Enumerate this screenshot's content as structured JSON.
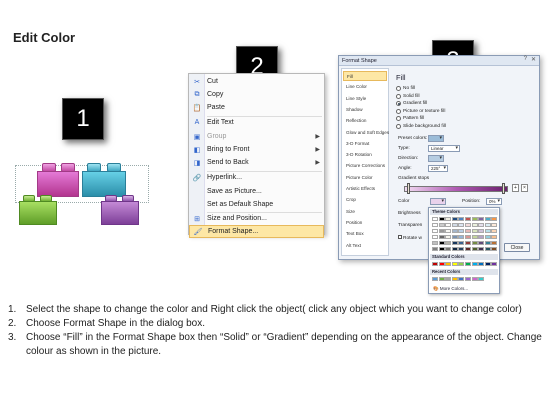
{
  "title": "Edit Color",
  "steps": [
    "1",
    "2",
    "3"
  ],
  "context_menu": {
    "items": [
      {
        "label": "Cut",
        "icon": "cut-icon",
        "glyph": "✂",
        "arrow": false,
        "disabled": false
      },
      {
        "label": "Copy",
        "icon": "copy-icon",
        "glyph": "⧉",
        "arrow": false,
        "disabled": false
      },
      {
        "label": "Paste",
        "icon": "paste-icon",
        "glyph": "📋",
        "arrow": false,
        "disabled": false
      },
      {
        "label": "Edit Text",
        "icon": "edit-text-icon",
        "glyph": "A",
        "arrow": false,
        "disabled": false
      },
      {
        "label": "Group",
        "icon": "group-icon",
        "glyph": "▣",
        "arrow": true,
        "disabled": true
      },
      {
        "label": "Bring to Front",
        "icon": "bring-to-front-icon",
        "glyph": "◧",
        "arrow": true,
        "disabled": false
      },
      {
        "label": "Send to Back",
        "icon": "send-to-back-icon",
        "glyph": "◨",
        "arrow": true,
        "disabled": false
      },
      {
        "label": "Hyperlink...",
        "icon": "hyperlink-icon",
        "glyph": "🔗",
        "arrow": false,
        "disabled": false
      },
      {
        "label": "Save as Picture...",
        "icon": "",
        "glyph": "",
        "arrow": false,
        "disabled": false
      },
      {
        "label": "Set as Default Shape",
        "icon": "",
        "glyph": "",
        "arrow": false,
        "disabled": false
      },
      {
        "label": "Size and Position...",
        "icon": "size-position-icon",
        "glyph": "⊞",
        "arrow": false,
        "disabled": false
      },
      {
        "label": "Format Shape...",
        "icon": "format-shape-icon",
        "glyph": "🖌",
        "arrow": false,
        "disabled": false
      }
    ]
  },
  "dialog": {
    "title": "Format Shape",
    "help": "?",
    "close_x": "✕",
    "nav": [
      "Fill",
      "Line Color",
      "Line Style",
      "Shadow",
      "Reflection",
      "Glow and Soft Edges",
      "3-D Format",
      "3-D Rotation",
      "Picture Corrections",
      "Picture Color",
      "Artistic Effects",
      "Crop",
      "Size",
      "Position",
      "Text Box",
      "Alt Text"
    ],
    "fill_heading": "Fill",
    "radios": [
      {
        "label": "No fill",
        "on": false
      },
      {
        "label": "Solid fill",
        "on": false
      },
      {
        "label": "Gradient fill",
        "on": true
      },
      {
        "label": "Picture or texture fill",
        "on": false
      },
      {
        "label": "Pattern fill",
        "on": false
      },
      {
        "label": "Slide background fill",
        "on": false
      }
    ],
    "preset_label": "Preset colors:",
    "type_label": "Type:",
    "type_value": "Linear",
    "direction_label": "Direction:",
    "angle_label": "Angle:",
    "angle_value": "225°",
    "stops_label": "Gradient stops",
    "color_label": "Color",
    "position_label": "Position:",
    "position_value": "0%",
    "brightness_label": "Brightness",
    "transparency_label": "Transparen",
    "rotate_label": "Rotate w",
    "close_label": "Close"
  },
  "palette": {
    "theme_label": "Theme Colors",
    "standard_label": "Standard Colors",
    "recent_label": "Recent Colors",
    "more_label": "More Colors...",
    "theme_top": [
      "#ffffff",
      "#000000",
      "#eeece1",
      "#1f497d",
      "#4f81bd",
      "#c0504d",
      "#9bbb59",
      "#8064a2",
      "#4bacc6",
      "#f79646"
    ],
    "standard": [
      "#c00000",
      "#ff0000",
      "#ffc000",
      "#ffff00",
      "#92d050",
      "#00b050",
      "#00b0f0",
      "#0070c0",
      "#002060",
      "#7030a0"
    ],
    "recent": [
      "#5b9bd5",
      "#70ad47",
      "#a5a5a5",
      "#ffc000",
      "#4472c4",
      "#9966cc",
      "#cc66cc",
      "#33cccc"
    ]
  },
  "instructions": [
    {
      "num": "1.",
      "text": "Select the shape to change the color and Right click the object( click any object which you want to change color)"
    },
    {
      "num": "2.",
      "text": "Choose Format Shape in the dialog box."
    },
    {
      "num": "3.",
      "text": "Choose “Fill” in the Format Shape box then “Solid” or “Gradient” depending on the appearance of the object. Change colour as shown in the picture."
    }
  ]
}
